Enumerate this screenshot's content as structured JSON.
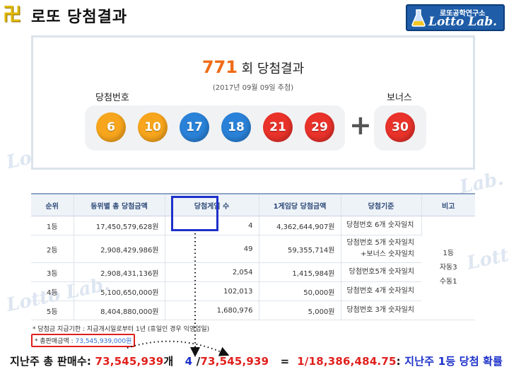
{
  "header": {
    "title": "로또 당첨결과",
    "logo_glyph": "卍",
    "brand_small": "로또공학연구소",
    "brand_large": "Lotto Lab."
  },
  "result": {
    "draw_number": "771",
    "draw_suffix": " 회 당첨결과",
    "draw_date": "(2017년 09월 09일 추첨)",
    "winning_label": "당첨번호",
    "bonus_label": "보너스",
    "plus": "+",
    "numbers": [
      {
        "value": "6",
        "color": "#f7a51c"
      },
      {
        "value": "10",
        "color": "#f7a51c"
      },
      {
        "value": "17",
        "color": "#2a82d8"
      },
      {
        "value": "18",
        "color": "#2a82d8"
      },
      {
        "value": "21",
        "color": "#e9322a"
      },
      {
        "value": "29",
        "color": "#e9322a"
      }
    ],
    "bonus": {
      "value": "30",
      "color": "#e9322a"
    }
  },
  "table": {
    "headers": [
      "순위",
      "등위별 총 당첨금액",
      "당첨게임 수",
      "1게임당 당첨금액",
      "당첨기준",
      "비고"
    ],
    "rows": [
      {
        "rank": "1등",
        "total": "17,450,579,628원",
        "games": "4",
        "per_game": "4,362,644,907원",
        "criteria_1": "당첨번호 6개 숫자일치",
        "criteria_2": ""
      },
      {
        "rank": "2등",
        "total": "2,908,429,986원",
        "games": "49",
        "per_game": "59,355,714원",
        "criteria_1": "당첨번호 5개 숫자일치",
        "criteria_2": "+보너스 숫자일치"
      },
      {
        "rank": "3등",
        "total": "2,908,431,136원",
        "games": "2,054",
        "per_game": "1,415,984원",
        "criteria_1": "당첨번호5개 숫자일치",
        "criteria_2": ""
      },
      {
        "rank": "4등",
        "total": "5,100,650,000원",
        "games": "102,013",
        "per_game": "50,000원",
        "criteria_1": "당첨번호 4개 숫자일치",
        "criteria_2": ""
      },
      {
        "rank": "5등",
        "total": "8,404,880,000원",
        "games": "1,680,976",
        "per_game": "5,000원",
        "criteria_1": "당첨번호 3개 숫자일치",
        "criteria_2": ""
      }
    ],
    "note": [
      "1등",
      "자동3",
      "수동1"
    ]
  },
  "footnotes": {
    "payout": "* 당첨금 지급기한 : 지급개시일로부터 1년 (휴일인 경우 익영업일)",
    "sales_label": "* 총판매금액 : ",
    "sales_value": "73,545,939,000원"
  },
  "summary": {
    "prefix": "지난주 총 판매수: ",
    "total_sold": "73,545,939",
    "unit": "개",
    "winners": "4",
    "slash": " /",
    "denominator": "73,545,939",
    "equals": " = ",
    "probability": "1/18,386,484.75",
    "colon": ": ",
    "suffix": "지난주 1등 당첨 확률"
  },
  "colors": {
    "accent_red": "#e0201c",
    "accent_blue": "#1d31c9",
    "draw_orange": "#ef6c17"
  }
}
